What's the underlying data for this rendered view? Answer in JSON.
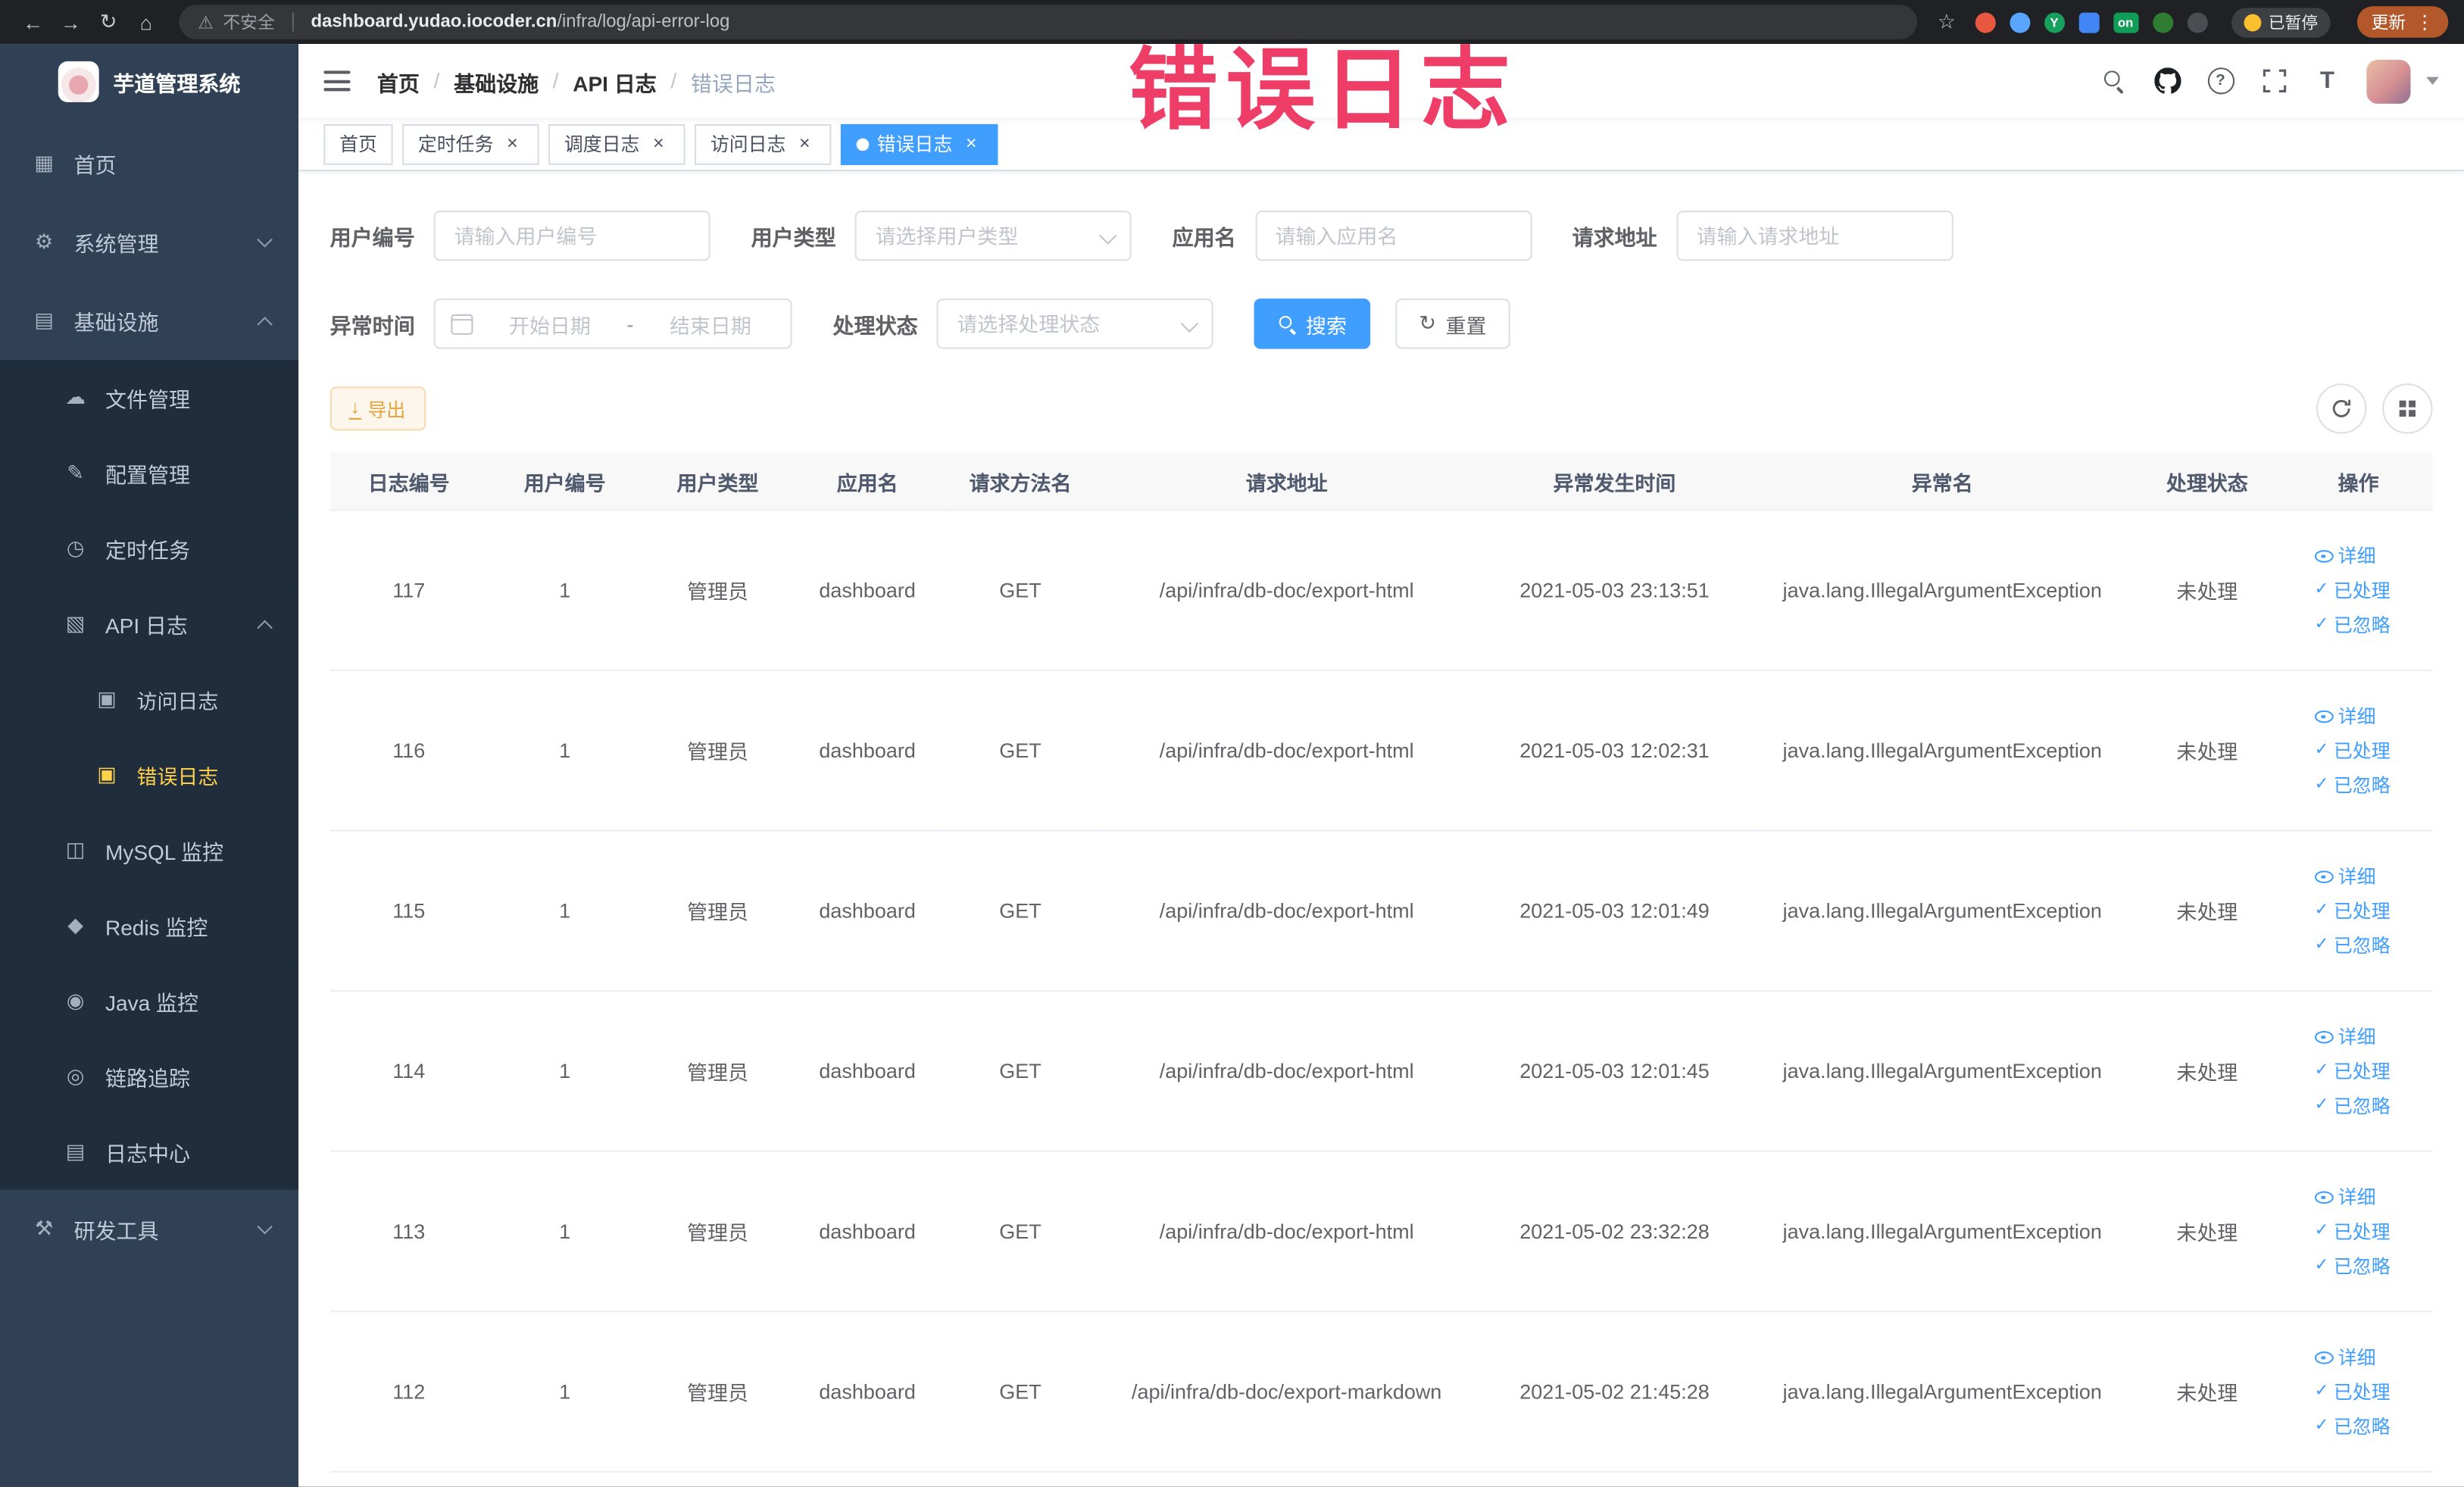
{
  "browser": {
    "back_icon": "←",
    "forward_icon": "→",
    "reload_icon": "↻",
    "home_icon": "⌂",
    "warning_icon": "⚠",
    "security_label": "不安全",
    "url_domain": "dashboard.yudao.iocoder.cn",
    "url_path": "/infra/log/api-error-log",
    "star_icon": "☆",
    "ext_y_label": "Y",
    "ext_on_label": "on",
    "paused_label": "已暂停",
    "update_label": "更新",
    "menu_icon": "⋮"
  },
  "watermark": "错误日志",
  "sidebar": {
    "logo_title": "芋道管理系统",
    "items": [
      {
        "key": "home",
        "label": "首页",
        "icon": "dashboard-icon",
        "glyph": "▦",
        "level": 1
      },
      {
        "key": "system",
        "label": "系统管理",
        "icon": "gear-icon",
        "glyph": "⚙",
        "level": 1,
        "chevron": "down"
      },
      {
        "key": "infra",
        "label": "基础设施",
        "icon": "infra-icon",
        "glyph": "▤",
        "level": 1,
        "chevron": "up"
      },
      {
        "key": "file-manage",
        "label": "文件管理",
        "icon": "cloud-icon",
        "glyph": "☁",
        "level": 2
      },
      {
        "key": "config-manage",
        "label": "配置管理",
        "icon": "edit-icon",
        "glyph": "✎",
        "level": 2
      },
      {
        "key": "scheduled-job",
        "label": "定时任务",
        "icon": "clock-icon",
        "glyph": "◷",
        "level": 2
      },
      {
        "key": "api-log",
        "label": "API 日志",
        "icon": "document-icon",
        "glyph": "▧",
        "level": 2,
        "chevron": "up"
      },
      {
        "key": "access-log",
        "label": "访问日志",
        "icon": "doc-edit-icon",
        "glyph": "▣",
        "level": 3
      },
      {
        "key": "error-log",
        "label": "错误日志",
        "icon": "doc-edit-icon",
        "glyph": "▣",
        "level": 3,
        "active": true
      },
      {
        "key": "mysql-monitor",
        "label": "MySQL 监控",
        "icon": "database-icon",
        "glyph": "◫",
        "level": 2
      },
      {
        "key": "redis-monitor",
        "label": "Redis 监控",
        "icon": "redis-icon",
        "glyph": "◆",
        "level": 2
      },
      {
        "key": "java-monitor",
        "label": "Java 监控",
        "icon": "java-icon",
        "glyph": "◉",
        "level": 2
      },
      {
        "key": "link-trace",
        "label": "链路追踪",
        "icon": "trace-icon",
        "glyph": "◎",
        "level": 2
      },
      {
        "key": "log-center",
        "label": "日志中心",
        "icon": "log-icon",
        "glyph": "▤",
        "level": 2
      },
      {
        "key": "dev-tools",
        "label": "研发工具",
        "icon": "tools-icon",
        "glyph": "⚒",
        "level": 1,
        "chevron": "down"
      }
    ]
  },
  "header": {
    "breadcrumbs": [
      "首页",
      "基础设施",
      "API 日志",
      "错误日志"
    ],
    "help_glyph": "?",
    "size_glyph": "T"
  },
  "tabs": [
    {
      "label": "首页",
      "closable": false,
      "active": false
    },
    {
      "label": "定时任务",
      "closable": true,
      "active": false
    },
    {
      "label": "调度日志",
      "closable": true,
      "active": false
    },
    {
      "label": "访问日志",
      "closable": true,
      "active": false
    },
    {
      "label": "错误日志",
      "closable": true,
      "active": true
    }
  ],
  "filters": {
    "user_id": {
      "label": "用户编号",
      "placeholder": "请输入用户编号"
    },
    "user_type": {
      "label": "用户类型",
      "placeholder": "请选择用户类型"
    },
    "app_name": {
      "label": "应用名",
      "placeholder": "请输入应用名"
    },
    "request_url": {
      "label": "请求地址",
      "placeholder": "请输入请求地址"
    },
    "exception_time": {
      "label": "异常时间",
      "start_placeholder": "开始日期",
      "separator": "-",
      "end_placeholder": "结束日期"
    },
    "process_status": {
      "label": "处理状态",
      "placeholder": "请选择处理状态"
    },
    "search_label": "搜索",
    "reset_label": "重置",
    "reset_glyph": "↻"
  },
  "toolbar": {
    "export_label": "导出",
    "export_glyph": "↓"
  },
  "glyphs": {
    "close": "×",
    "check": "✓"
  },
  "table": {
    "columns": [
      "日志编号",
      "用户编号",
      "用户类型",
      "应用名",
      "请求方法名",
      "请求地址",
      "异常发生时间",
      "异常名",
      "处理状态",
      "操作"
    ],
    "row_actions": [
      "详细",
      "已处理",
      "已忽略"
    ],
    "rows": [
      {
        "id": "117",
        "user_id": "1",
        "user_type": "管理员",
        "app": "dashboard",
        "method": "GET",
        "url": "/api/infra/db-doc/export-html",
        "time": "2021-05-03 23:13:51",
        "exception": "java.lang.IllegalArgumentException",
        "status": "未处理"
      },
      {
        "id": "116",
        "user_id": "1",
        "user_type": "管理员",
        "app": "dashboard",
        "method": "GET",
        "url": "/api/infra/db-doc/export-html",
        "time": "2021-05-03 12:02:31",
        "exception": "java.lang.IllegalArgumentException",
        "status": "未处理"
      },
      {
        "id": "115",
        "user_id": "1",
        "user_type": "管理员",
        "app": "dashboard",
        "method": "GET",
        "url": "/api/infra/db-doc/export-html",
        "time": "2021-05-03 12:01:49",
        "exception": "java.lang.IllegalArgumentException",
        "status": "未处理"
      },
      {
        "id": "114",
        "user_id": "1",
        "user_type": "管理员",
        "app": "dashboard",
        "method": "GET",
        "url": "/api/infra/db-doc/export-html",
        "time": "2021-05-03 12:01:45",
        "exception": "java.lang.IllegalArgumentException",
        "status": "未处理"
      },
      {
        "id": "113",
        "user_id": "1",
        "user_type": "管理员",
        "app": "dashboard",
        "method": "GET",
        "url": "/api/infra/db-doc/export-html",
        "time": "2021-05-02 23:32:28",
        "exception": "java.lang.IllegalArgumentException",
        "status": "未处理"
      },
      {
        "id": "112",
        "user_id": "1",
        "user_type": "管理员",
        "app": "dashboard",
        "method": "GET",
        "url": "/api/infra/db-doc/export-markdown",
        "time": "2021-05-02 21:45:28",
        "exception": "java.lang.IllegalArgumentException",
        "status": "未处理"
      }
    ]
  }
}
